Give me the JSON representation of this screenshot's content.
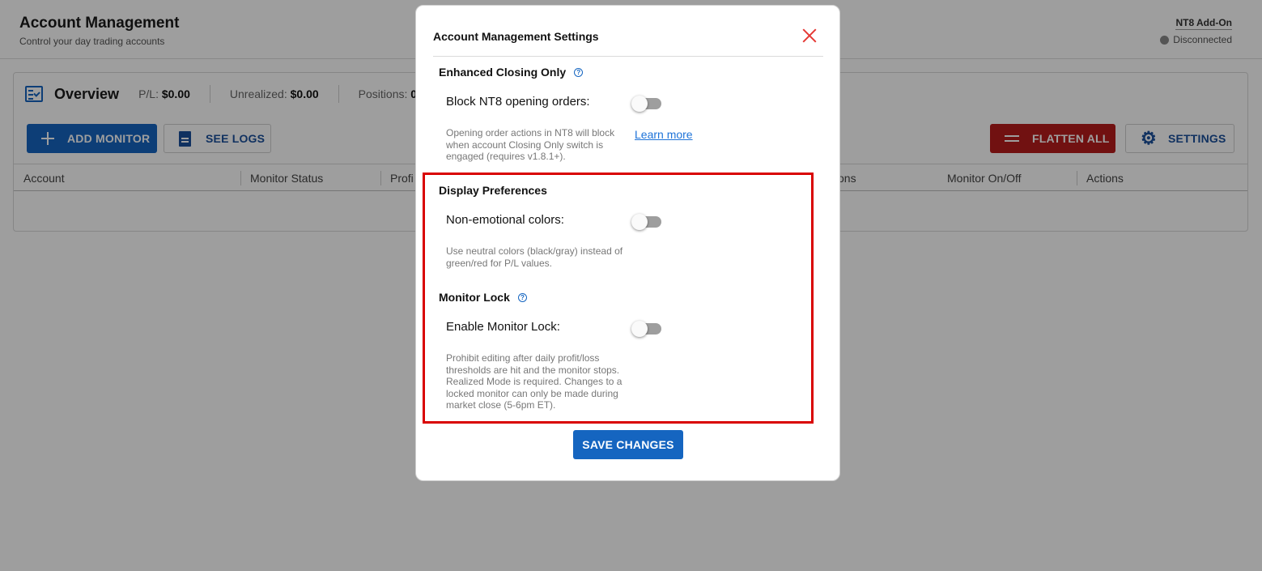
{
  "header": {
    "title": "Account Management",
    "subtitle": "Control your day trading accounts",
    "addon_label": "NT8 Add-On",
    "status": "Disconnected"
  },
  "overview": {
    "title": "Overview",
    "pl_label": "P/L:",
    "pl_value": "$0.00",
    "unrealized_label": "Unrealized:",
    "unrealized_value": "$0.00",
    "positions_label": "Positions:",
    "positions_value": "0"
  },
  "toolbar": {
    "add_monitor": "ADD MONITOR",
    "see_logs": "SEE LOGS",
    "flatten_all": "FLATTEN ALL",
    "settings": "SETTINGS"
  },
  "table": {
    "columns": [
      "Account",
      "Monitor Status",
      "Profi",
      "ons",
      "Monitor On/Off",
      "Actions"
    ]
  },
  "modal": {
    "title": "Account Management Settings",
    "sections": {
      "enhanced_closing": {
        "title": "Enhanced Closing Only",
        "option_label": "Block NT8 opening orders:",
        "enabled": false,
        "description": "Opening order actions in NT8 will block when account Closing Only switch is engaged (requires v1.8.1+).",
        "learn_more": "Learn more"
      },
      "display_preferences": {
        "title": "Display Preferences",
        "option_label": "Non-emotional colors:",
        "enabled": false,
        "description": "Use neutral colors (black/gray) instead of green/red for P/L values."
      },
      "monitor_lock": {
        "title": "Monitor Lock",
        "option_label": "Enable Monitor Lock:",
        "enabled": false,
        "description": "Prohibit editing after daily profit/loss thresholds are hit and the monitor stops. Realized Mode is required. Changes to a locked monitor can only be made during market close (5-6pm ET)."
      }
    },
    "save_label": "SAVE CHANGES"
  },
  "colors": {
    "primary": "#1565c0",
    "danger": "#b71c1c",
    "highlight": "#d90000",
    "close": "#e53935"
  }
}
